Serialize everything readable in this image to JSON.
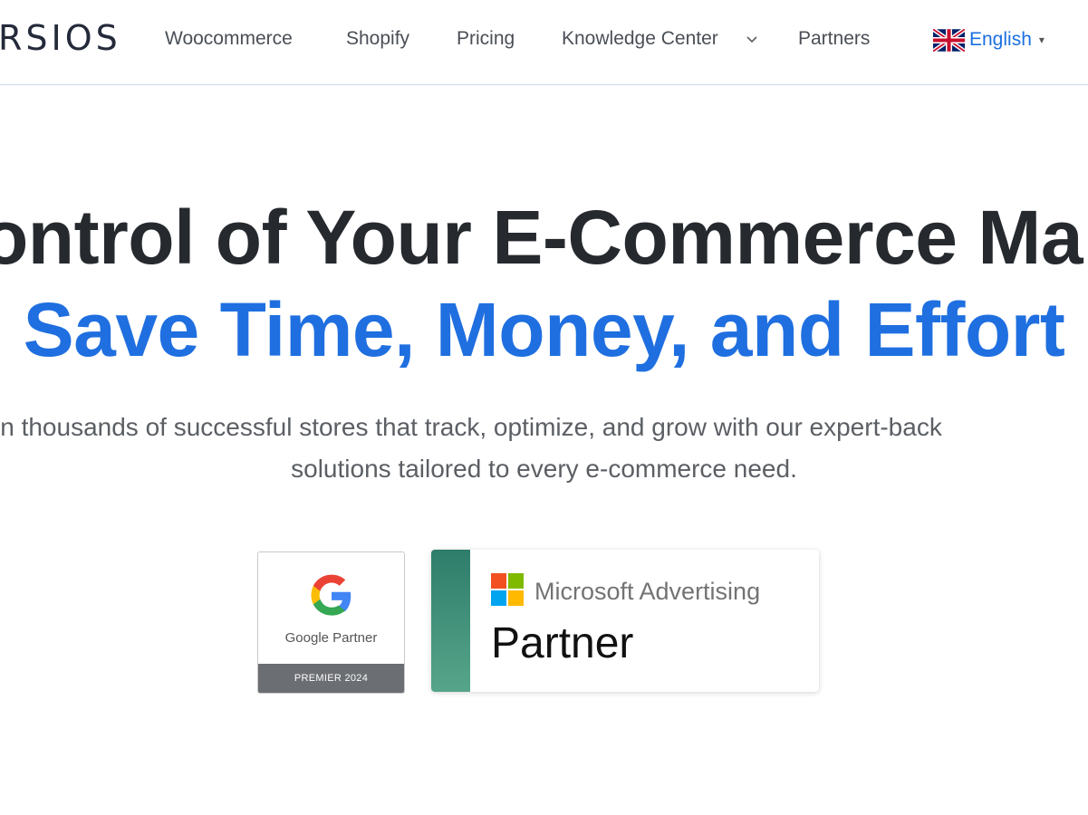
{
  "header": {
    "logo_text": "RSIOS",
    "nav": {
      "woocommerce": "Woocommerce",
      "shopify": "Shopify",
      "pricing": "Pricing",
      "knowledge_center": "Knowledge Center",
      "partners": "Partners"
    },
    "language": {
      "label": "English",
      "flag_icon": "uk-flag-icon",
      "caret": "▾"
    }
  },
  "hero": {
    "headline_line1": "ontrol of Your E-Commerce Ma",
    "headline_line2": "Save Time, Money, and Effort",
    "subtext_line1": "in thousands of successful stores that track, optimize, and grow with our expert-back",
    "subtext_line2": "solutions tailored to every e-commerce need."
  },
  "badges": {
    "google": {
      "label": "Google Partner",
      "footer": "PREMIER 2024"
    },
    "microsoft": {
      "title": "Microsoft Advertising",
      "partner": "Partner"
    }
  },
  "colors": {
    "accent_blue": "#1f6fe0",
    "headline_dark": "#262a2f",
    "nav_text": "#4a4f56",
    "ms_stripe": "#2e7d6b"
  }
}
